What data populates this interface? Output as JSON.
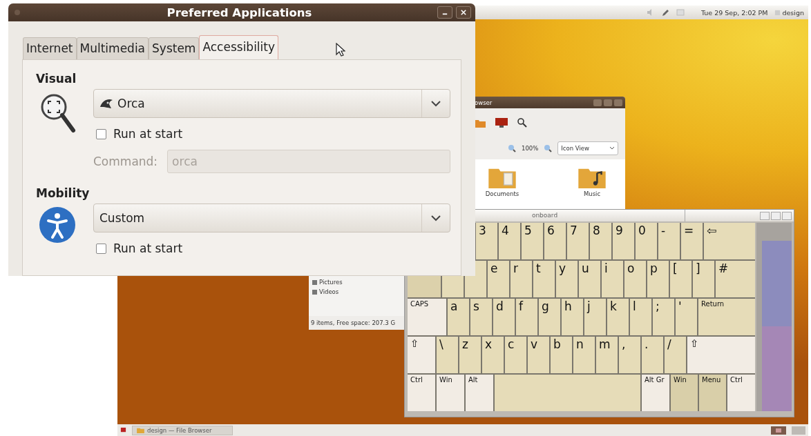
{
  "top_panel": {
    "clock": "Tue 29 Sep, 2:02 PM",
    "user": "design"
  },
  "taskbar": {
    "tasks": [
      {
        "label": "design — File Browser"
      }
    ]
  },
  "file_browser": {
    "title": "owser",
    "zoom": "100%",
    "view": "Icon View",
    "items": [
      {
        "label": "Documents",
        "kind": "documents"
      },
      {
        "label": "Music",
        "kind": "music"
      }
    ],
    "places": [
      {
        "label": "Pictures"
      },
      {
        "label": "Videos"
      }
    ],
    "status": "9 items, Free space: 207.3 G"
  },
  "onboard": {
    "title": "onboard",
    "rows": [
      {
        "keys": [
          {
            "kind": "char"
          },
          {
            "kind": "char"
          },
          {
            "kind": "char"
          },
          {
            "kind": "char",
            "label": "3"
          },
          {
            "kind": "char",
            "label": "4"
          },
          {
            "kind": "char",
            "label": "5"
          },
          {
            "kind": "char",
            "label": "6"
          },
          {
            "kind": "char",
            "label": "7"
          },
          {
            "kind": "char",
            "label": "8"
          },
          {
            "kind": "char",
            "label": "9"
          },
          {
            "kind": "char",
            "label": "0"
          },
          {
            "kind": "char",
            "label": "-"
          },
          {
            "kind": "char",
            "label": "="
          },
          {
            "kind": "wide",
            "label": "⇦"
          }
        ]
      },
      {
        "keys": [
          {
            "kind": "tab"
          },
          {
            "kind": "char"
          },
          {
            "kind": "char"
          },
          {
            "kind": "char",
            "label": "e"
          },
          {
            "kind": "char",
            "label": "r"
          },
          {
            "kind": "char",
            "label": "t"
          },
          {
            "kind": "char",
            "label": "y"
          },
          {
            "kind": "char",
            "label": "u"
          },
          {
            "kind": "char",
            "label": "i"
          },
          {
            "kind": "char",
            "label": "o"
          },
          {
            "kind": "char",
            "label": "p"
          },
          {
            "kind": "char",
            "label": "["
          },
          {
            "kind": "char",
            "label": "]"
          },
          {
            "kind": "wide",
            "label": "#"
          }
        ]
      },
      {
        "keys": [
          {
            "kind": "caps",
            "label": "CAPS"
          },
          {
            "kind": "char",
            "label": "a"
          },
          {
            "kind": "char",
            "label": "s"
          },
          {
            "kind": "char",
            "label": "d"
          },
          {
            "kind": "char",
            "label": "f"
          },
          {
            "kind": "char",
            "label": "g"
          },
          {
            "kind": "char",
            "label": "h"
          },
          {
            "kind": "char",
            "label": "j"
          },
          {
            "kind": "char",
            "label": "k"
          },
          {
            "kind": "char",
            "label": "l"
          },
          {
            "kind": "char",
            "label": ";"
          },
          {
            "kind": "char",
            "label": "'"
          },
          {
            "kind": "enter",
            "label": "Return"
          }
        ]
      },
      {
        "keys": [
          {
            "kind": "shift",
            "label": "⇧"
          },
          {
            "kind": "char",
            "label": "\\"
          },
          {
            "kind": "char",
            "label": "z"
          },
          {
            "kind": "char",
            "label": "x"
          },
          {
            "kind": "char",
            "label": "c"
          },
          {
            "kind": "char",
            "label": "v"
          },
          {
            "kind": "char",
            "label": "b"
          },
          {
            "kind": "char",
            "label": "n"
          },
          {
            "kind": "char",
            "label": "m"
          },
          {
            "kind": "char",
            "label": ","
          },
          {
            "kind": "char",
            "label": "."
          },
          {
            "kind": "char",
            "label": "/"
          },
          {
            "kind": "shiftwide",
            "label": "⇧"
          }
        ]
      },
      {
        "keys": [
          {
            "kind": "mod",
            "label": "Ctrl"
          },
          {
            "kind": "mod",
            "label": "Win"
          },
          {
            "kind": "mod",
            "label": "Alt"
          },
          {
            "kind": "space"
          },
          {
            "kind": "mod",
            "label": "Alt Gr"
          },
          {
            "kind": "dark",
            "label": "Win"
          },
          {
            "kind": "dark",
            "label": "Menu"
          },
          {
            "kind": "mod",
            "label": "Ctrl"
          }
        ]
      }
    ]
  },
  "dialog": {
    "title": "Preferred Applications",
    "tabs": [
      {
        "label": "Internet",
        "selected": false
      },
      {
        "label": "Multimedia",
        "selected": false
      },
      {
        "label": "System",
        "selected": false
      },
      {
        "label": "Accessibility",
        "selected": true
      }
    ],
    "sections": [
      {
        "kind": "visual",
        "heading": "Visual",
        "application": {
          "label": "Orca",
          "kind": "orca"
        },
        "run_at_start": {
          "label": "Run at start",
          "checked": false
        },
        "command": {
          "label": "Command:",
          "value": "orca",
          "disabled": true
        }
      },
      {
        "kind": "mobility",
        "heading": "Mobility",
        "application": {
          "label": "Custom",
          "kind": "plain"
        },
        "run_at_start": {
          "label": "Run at start",
          "checked": false
        }
      }
    ]
  }
}
